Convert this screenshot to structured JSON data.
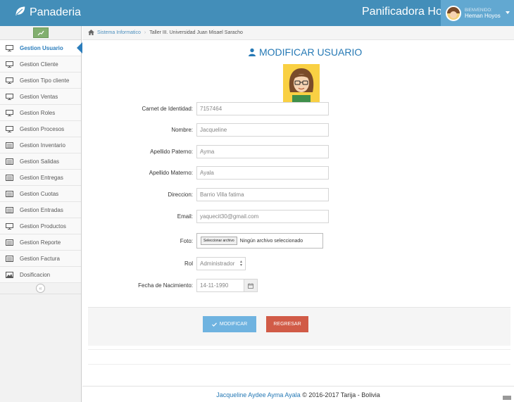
{
  "app": {
    "brand": "Panaderia",
    "company": "Panificadora Hoyos"
  },
  "user": {
    "welcome": "BIENVENIDO:",
    "name": "Heman Hoyos"
  },
  "sidebar": {
    "items": [
      {
        "label": "Gestion Usuario",
        "icon": "desktop-icon"
      },
      {
        "label": "Gestion Cliente",
        "icon": "desktop-icon"
      },
      {
        "label": "Gestion Tipo cliente",
        "icon": "desktop-icon"
      },
      {
        "label": "Gestion Ventas",
        "icon": "desktop-icon"
      },
      {
        "label": "Gestion Roles",
        "icon": "desktop-icon"
      },
      {
        "label": "Gestion Procesos",
        "icon": "desktop-icon"
      },
      {
        "label": "Gestion Inventario",
        "icon": "list-icon"
      },
      {
        "label": "Gestion Salidas",
        "icon": "list-icon"
      },
      {
        "label": "Gestion Entregas",
        "icon": "list-icon"
      },
      {
        "label": "Gestion Cuotas",
        "icon": "list-icon"
      },
      {
        "label": "Gestion Entradas",
        "icon": "list-icon"
      },
      {
        "label": "Gestion Productos",
        "icon": "desktop-icon"
      },
      {
        "label": "Gestion Reporte",
        "icon": "list-icon"
      },
      {
        "label": "Gestion Factura",
        "icon": "list-icon"
      },
      {
        "label": "Dosificacion",
        "icon": "picture-icon"
      }
    ],
    "collapse_symbol": "«"
  },
  "breadcrumb": {
    "home": "Sistema Informatico",
    "current": "Taller III. Universidad Juan Misael Saracho"
  },
  "page": {
    "title": "MODIFICAR USUARIO"
  },
  "form": {
    "ci_label": "Carnet de Identidad:",
    "ci_value": "7157464",
    "nombre_label": "Nombre:",
    "nombre_value": "Jacqueline",
    "paterno_label": "Apellido Paterno:",
    "paterno_value": "Ayma",
    "materno_label": "Apellido Materno:",
    "materno_value": "Ayala",
    "direccion_label": "Direccion:",
    "direccion_value": "Barrio Villa fatima",
    "email_label": "Email:",
    "email_value": "yaquecit30@gmail.com",
    "foto_label": "Foto:",
    "file_button": "Seleccionar archivo",
    "file_status": "Ningún archivo seleccionado",
    "rol_label": "Rol",
    "rol_value": "Administrador",
    "fecha_label": "Fecha de Nacimiento:",
    "fecha_value": "14-11-1990"
  },
  "buttons": {
    "modificar": "MODIFICAR",
    "regresar": "REGRESAR"
  },
  "footer": {
    "name": "Jacqueline Aydee Ayma Ayala",
    "rest": " © 2016-2017 Tarija - Bolivia"
  },
  "colors": {
    "navbar": "#438eb9",
    "accent": "#2679b5",
    "primary_btn": "#6fb3e0",
    "danger_btn": "#d15b47",
    "shortcut": "#82af6f"
  }
}
